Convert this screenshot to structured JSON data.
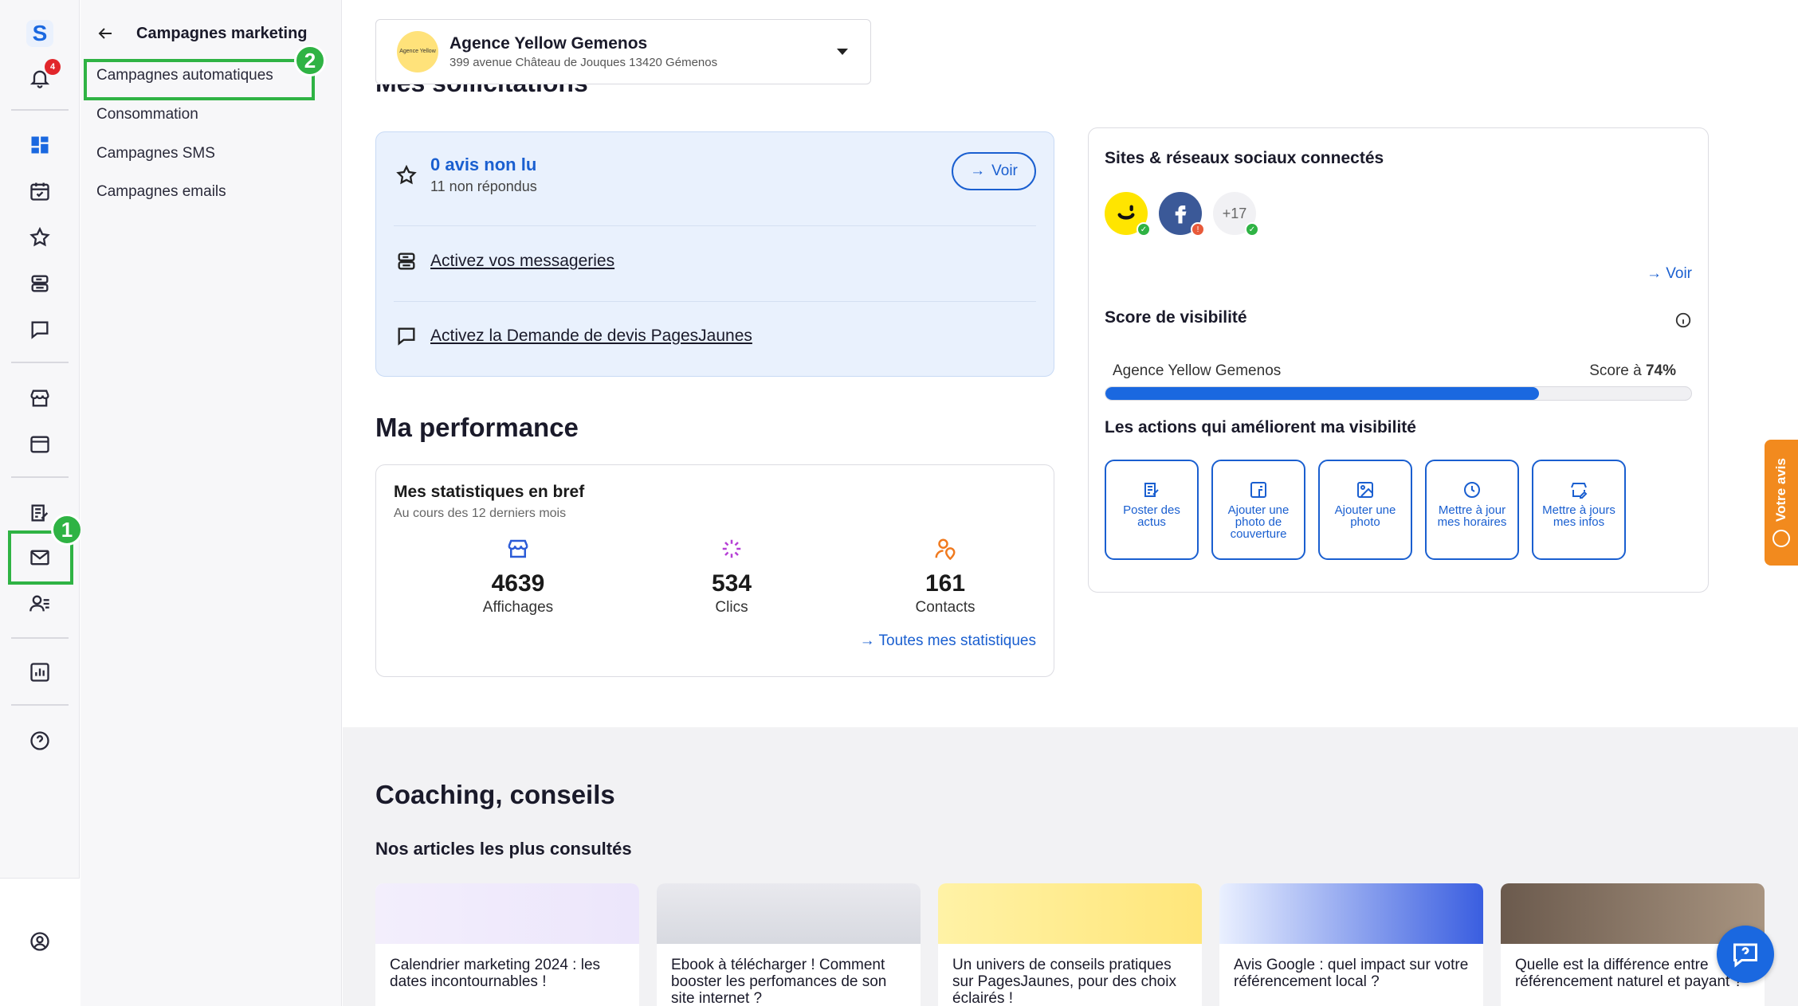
{
  "rail": {
    "logo_letter": "S",
    "notification_count": "4",
    "badge_color": "#e1262b"
  },
  "submenu": {
    "title": "Campagnes marketing",
    "items": [
      {
        "label": "Campagnes automatiques"
      },
      {
        "label": "Consommation"
      },
      {
        "label": "Campagnes SMS"
      },
      {
        "label": "Campagnes emails"
      }
    ]
  },
  "highlights": {
    "one": "1",
    "two": "2",
    "color": "#2fb344"
  },
  "agency": {
    "name": "Agence Yellow Gemenos",
    "address": "399 avenue Château de Jouques 13420 Gémenos",
    "logo_text": "Agence Yellow"
  },
  "sollicitations": {
    "title": "Mes sollicitations",
    "avis_main": "0 avis non lu",
    "avis_sub": "11 non répondus",
    "voir_label": "Voir",
    "link_messageries": "Activez vos messageries",
    "link_devis": "Activez la Demande de devis PagesJaunes"
  },
  "performance": {
    "heading": "Ma performance",
    "card_title": "Mes statistiques en bref",
    "card_sub": "Au cours des 12 derniers mois",
    "stats": [
      {
        "value": "4639",
        "label": "Affichages"
      },
      {
        "value": "534",
        "label": "Clics"
      },
      {
        "value": "161",
        "label": "Contacts"
      }
    ],
    "link_all": "Toutes mes statistiques"
  },
  "social": {
    "title": "Sites & réseaux sociaux connectés",
    "more_count": "+17",
    "voir_label": "Voir"
  },
  "visibility": {
    "title": "Score de visibilité",
    "agency_label": "Agence Yellow Gemenos",
    "score_prefix": "Score à",
    "score_value": "74%",
    "score_fraction": 0.74,
    "actions_title": "Les actions qui améliorent ma visibilité",
    "actions": [
      {
        "label": "Poster des actus"
      },
      {
        "label": "Ajouter une photo de couverture"
      },
      {
        "label": "Ajouter une photo"
      },
      {
        "label": "Mettre à jour mes horaires"
      },
      {
        "label": "Mettre à jours mes infos"
      }
    ],
    "accent_color": "#1a5fd0"
  },
  "feedback_tab": {
    "label": "Votre avis",
    "color": "#f28a1e"
  },
  "coaching": {
    "heading": "Coaching, conseils",
    "articles_heading": "Nos articles les plus consultés",
    "articles": [
      {
        "title": "Calendrier marketing 2024 : les dates incontournables !"
      },
      {
        "title": "Ebook à télécharger ! Comment booster les perfomances de son site internet ?"
      },
      {
        "title": "Un univers de conseils pratiques sur PagesJaunes, pour des choix éclairés !"
      },
      {
        "title": "Avis Google : quel impact sur votre référencement local ?"
      },
      {
        "title": "Quelle est la différence entre référencement naturel et payant ?"
      }
    ]
  }
}
